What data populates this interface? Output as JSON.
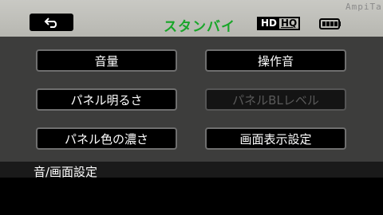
{
  "header": {
    "back_icon": "return-arrow-icon",
    "status": "スタンバイ",
    "quality_hd": "HD",
    "quality_hq": "HQ",
    "battery_icon": "battery-icon",
    "status_color": "#19a629"
  },
  "watermark": "AmpiTa",
  "menu": {
    "sound_volume": "音量",
    "operation_sound": "操作音",
    "panel_brightness": "パネル明るさ",
    "panel_backlight_level": "パネルBLレベル",
    "panel_color_depth": "パネル色の濃さ",
    "display_settings": "画面表示設定"
  },
  "footer": {
    "category": "音/画面設定"
  }
}
